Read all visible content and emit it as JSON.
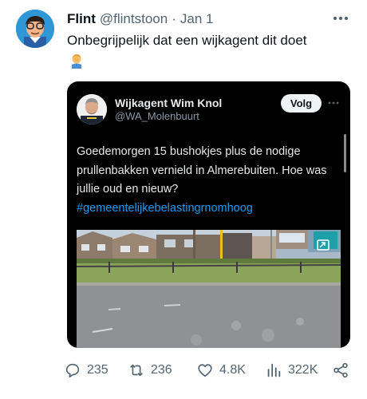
{
  "tweet": {
    "author": {
      "display_name": "Flint",
      "handle": "@flintstoon",
      "separator": "·",
      "date": "Jan 1"
    },
    "text": "Onbegrijpelijk dat een wijkagent dit doet",
    "emoji": "man-facepalming-emoji"
  },
  "quoted": {
    "author": {
      "display_name": "Wijkagent Wim Knol",
      "handle": "@WA_Molenbuurt"
    },
    "follow_label": "Volg",
    "text": "Goedemorgen 15 bushokjes plus de nodige prullenbakken vernield in Almerebuiten. Hoe was jullie oud en nieuw?",
    "hashtag": "#gemeentelijkebelastingrnomhoog"
  },
  "actions": {
    "replies": "235",
    "retweets": "236",
    "likes": "4.8K",
    "views": "322K"
  },
  "colors": {
    "accent": "#1d9bf0",
    "muted": "#536471",
    "text": "#0f1419",
    "embed_bg": "#000000"
  },
  "icons": [
    "more-icon",
    "reply-icon",
    "retweet-icon",
    "like-icon",
    "views-icon",
    "share-icon",
    "pip-icon"
  ]
}
